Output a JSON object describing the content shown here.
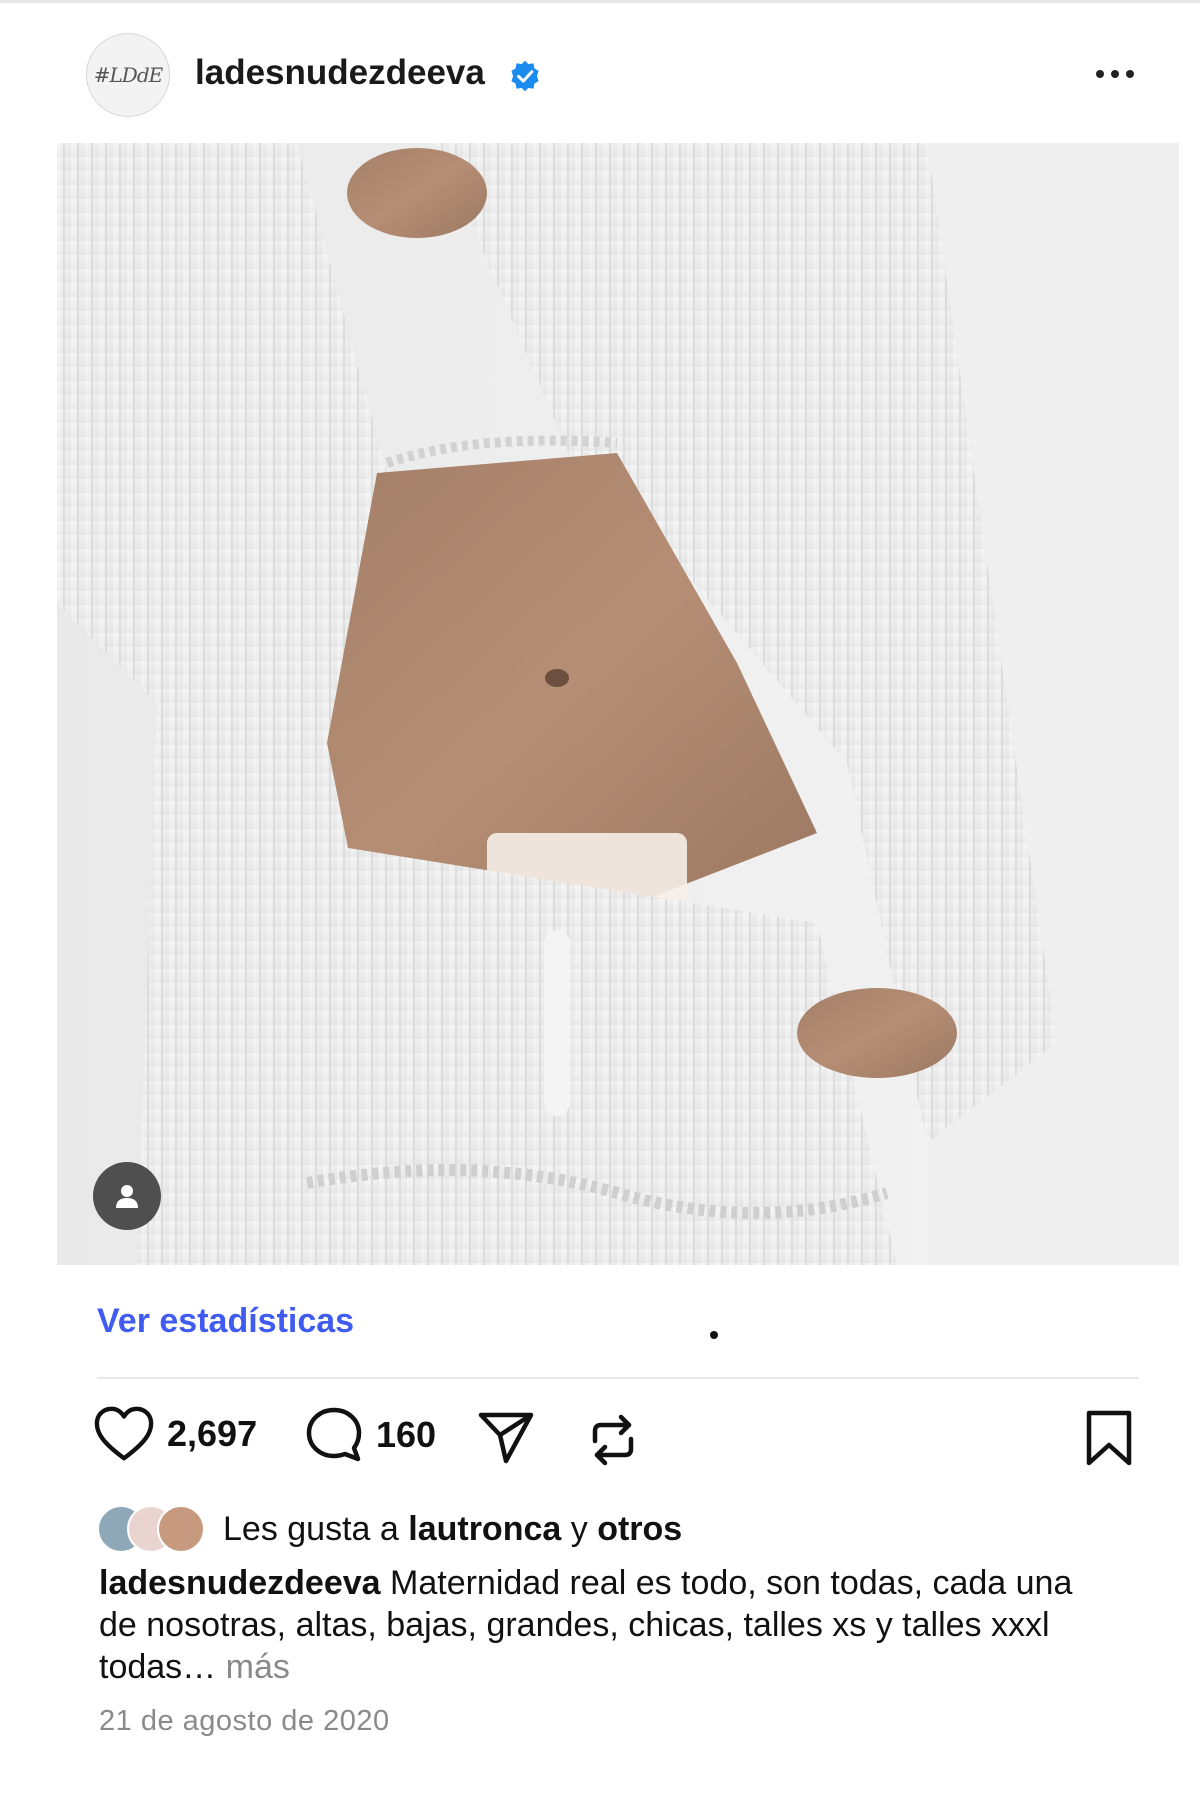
{
  "post": {
    "author": {
      "username": "ladesnudezdeeva",
      "avatar_text": "#LDdE",
      "verified": true
    },
    "header": {
      "more_icon": "more-horizontal-icon"
    },
    "image": {
      "alt": ""
    },
    "stats_link": "Ver estadísticas",
    "actions": {
      "likes_count": "2,697",
      "comments_count": "160",
      "icons": [
        "heart-icon",
        "comment-icon",
        "send-icon",
        "repost-icon",
        "bookmark-icon"
      ]
    },
    "liked_by": {
      "prefix": "Les gusta a",
      "user": "lautronca",
      "conjunction": "y",
      "others": "otros"
    },
    "caption": {
      "username": "ladesnudezdeeva",
      "text": "Maternidad real es todo, son todas, cada una de nosotras, altas, bajas, grandes, chicas, talles xs y talles xxxl todas…",
      "more": "más"
    },
    "date": "21 de agosto de 2020",
    "colors": {
      "link": "#3f5bf0",
      "verified": "#1a8cf0",
      "muted": "#8a8a8a"
    }
  }
}
